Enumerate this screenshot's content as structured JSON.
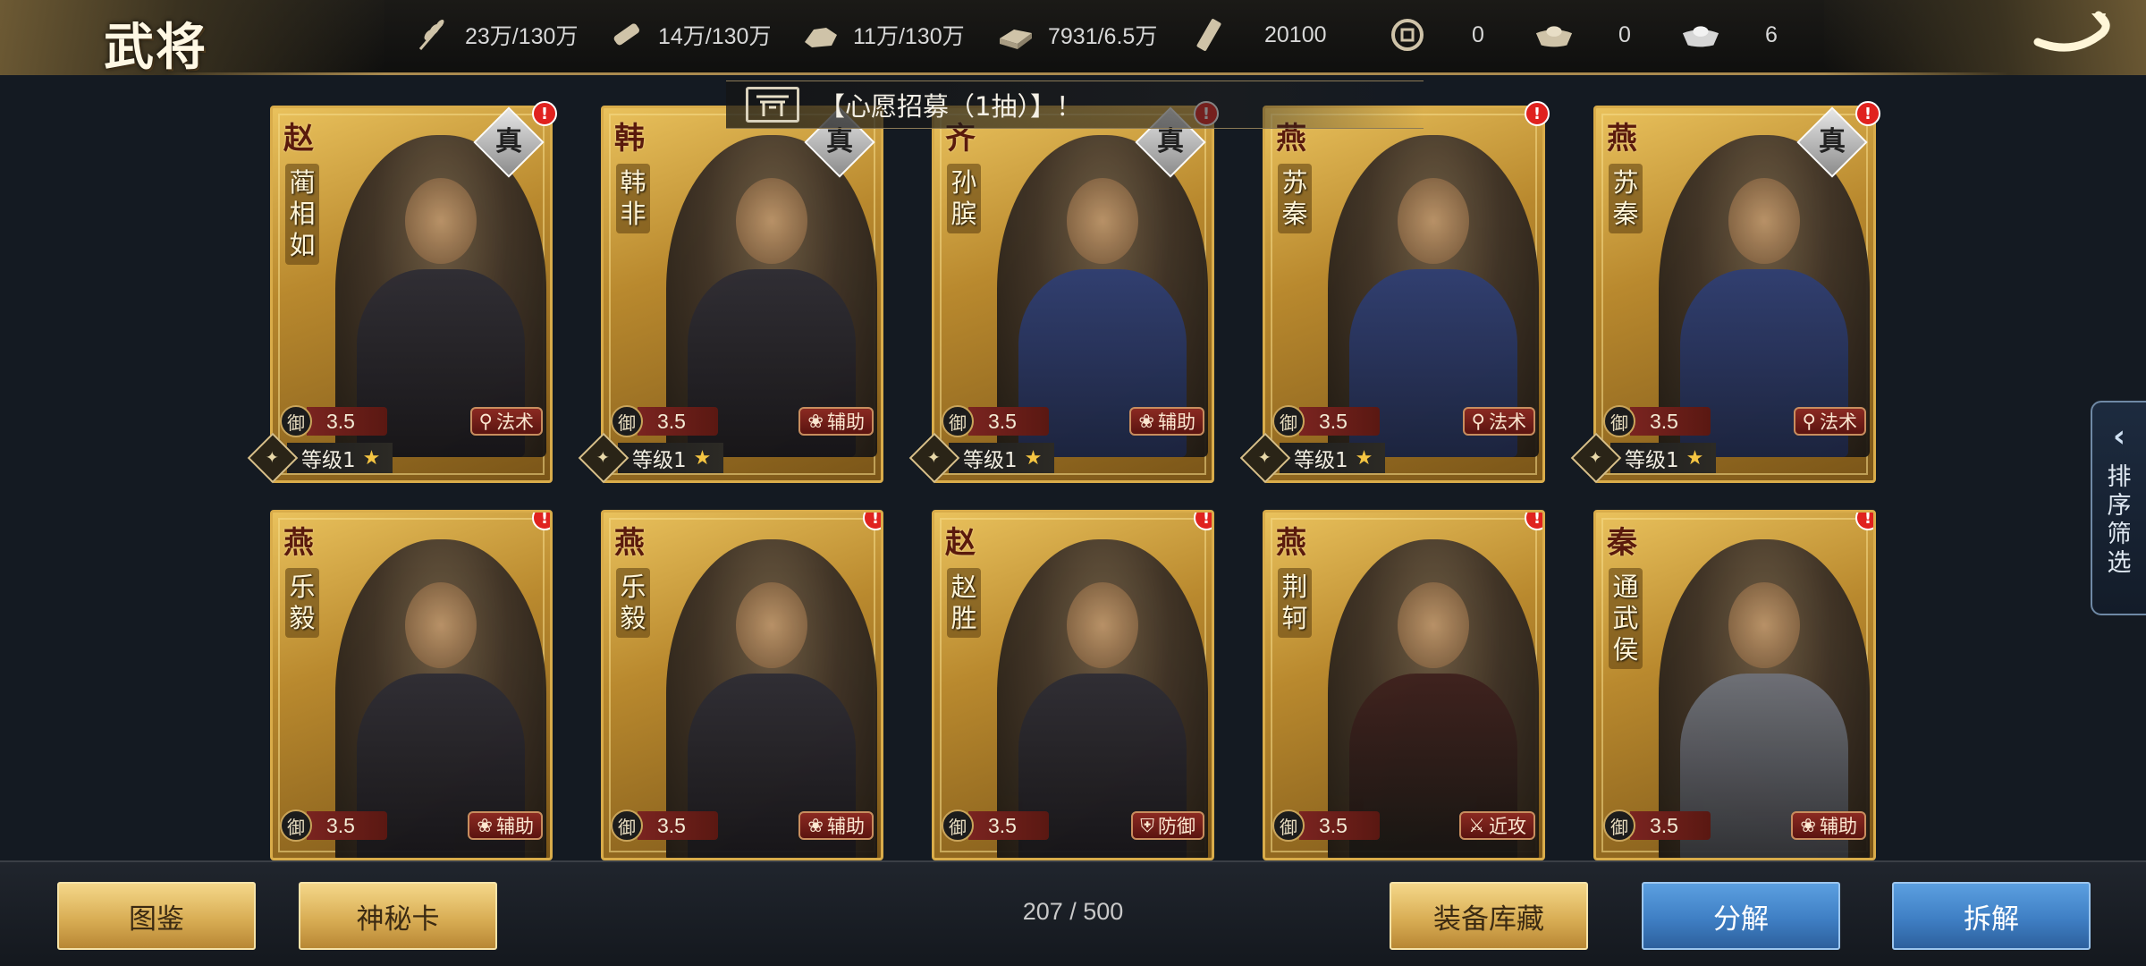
{
  "header": {
    "title": "武将",
    "resources": [
      {
        "icon": "grain-icon",
        "value": "23万/130万"
      },
      {
        "icon": "wood-icon",
        "value": "14万/130万"
      },
      {
        "icon": "stone-icon",
        "value": "11万/130万"
      },
      {
        "icon": "iron-icon",
        "value": "7931/6.5万"
      },
      {
        "icon": "command-token-icon",
        "value": "20100"
      },
      {
        "icon": "copper-coin-icon",
        "value": "0"
      },
      {
        "icon": "gold-ingot-icon",
        "value": "0"
      },
      {
        "icon": "silver-ingot-icon",
        "value": "6"
      }
    ],
    "back_icon": "back-arrow-icon"
  },
  "notice": {
    "icon": "gate-icon",
    "text": "【心愿招募（1抽）】！"
  },
  "generals": [
    {
      "state": "赵",
      "name": "蔺相如",
      "badge": "真",
      "rating": "3.5",
      "role": "法术",
      "level": "等级1",
      "art": "dark",
      "alert": "!"
    },
    {
      "state": "韩",
      "name": "韩非",
      "badge": "真",
      "rating": "3.5",
      "role": "辅助",
      "level": "等级1",
      "art": "dark",
      "alert": ""
    },
    {
      "state": "齐",
      "name": "孙膑",
      "badge": "真",
      "rating": "3.5",
      "role": "辅助",
      "level": "等级1",
      "art": "blue",
      "alert": "!"
    },
    {
      "state": "燕",
      "name": "苏秦",
      "badge": "",
      "rating": "3.5",
      "role": "法术",
      "level": "等级1",
      "art": "blue",
      "alert": "!"
    },
    {
      "state": "燕",
      "name": "苏秦",
      "badge": "真",
      "rating": "3.5",
      "role": "法术",
      "level": "等级1",
      "art": "blue",
      "alert": "!"
    },
    {
      "state": "燕",
      "name": "乐毅",
      "badge": "",
      "rating": "3.5",
      "role": "辅助",
      "level": "",
      "art": "dark",
      "alert": "!"
    },
    {
      "state": "燕",
      "name": "乐毅",
      "badge": "",
      "rating": "3.5",
      "role": "辅助",
      "level": "",
      "art": "dark",
      "alert": "!"
    },
    {
      "state": "赵",
      "name": "赵胜",
      "badge": "",
      "rating": "3.5",
      "role": "防御",
      "level": "",
      "art": "dark",
      "alert": "!"
    },
    {
      "state": "燕",
      "name": "荆轲",
      "badge": "",
      "rating": "3.5",
      "role": "近攻",
      "level": "",
      "art": "red",
      "alert": "!"
    },
    {
      "state": "秦",
      "name": "通武侯",
      "badge": "",
      "rating": "3.5",
      "role": "辅助",
      "level": "",
      "art": "silver",
      "alert": "!"
    }
  ],
  "labels": {
    "defense_icon_char": "御",
    "star": "★"
  },
  "side_tab": {
    "label": "排序筛选"
  },
  "footer": {
    "buttons": {
      "codex": "图鉴",
      "mystery_card": "神秘卡",
      "equipment_storage": "装备库藏",
      "decompose": "分解",
      "dismantle": "拆解"
    },
    "count": "207 / 500"
  },
  "colors": {
    "gold_button": "#d9ae55",
    "blue_button": "#3f7fc4",
    "alert_red": "#e0221f",
    "card_gold": "#d9ac4a"
  }
}
